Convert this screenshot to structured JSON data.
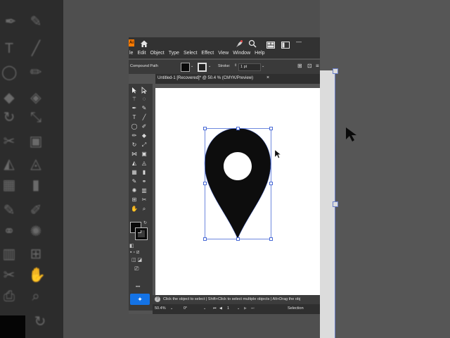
{
  "app": {
    "logo": "Ai",
    "menus": [
      "le",
      "Edit",
      "Object",
      "Type",
      "Select",
      "Effect",
      "View",
      "Window",
      "Help"
    ],
    "control_bar": {
      "selection_type": "Compound Path",
      "stroke_label": "Stroke:",
      "stroke_value": "1 pt"
    },
    "document_tab": {
      "title": "Untitled-1 [Recovered]* @ 50.4 % (CMYK/Preview)",
      "close": "×"
    },
    "status_hint": "Click the object to select  |  Shift+Click to select multiple objects  |  Alt+Drag the obj",
    "bottom": {
      "zoom": "50.4%",
      "rotation": "0°",
      "artboard": "1",
      "mode": "Selection"
    },
    "more_tools": "•••"
  },
  "colors": {
    "accent": "#1473e6",
    "selection": "#4a6bd6",
    "shape_fill": "#0d0d0d"
  }
}
